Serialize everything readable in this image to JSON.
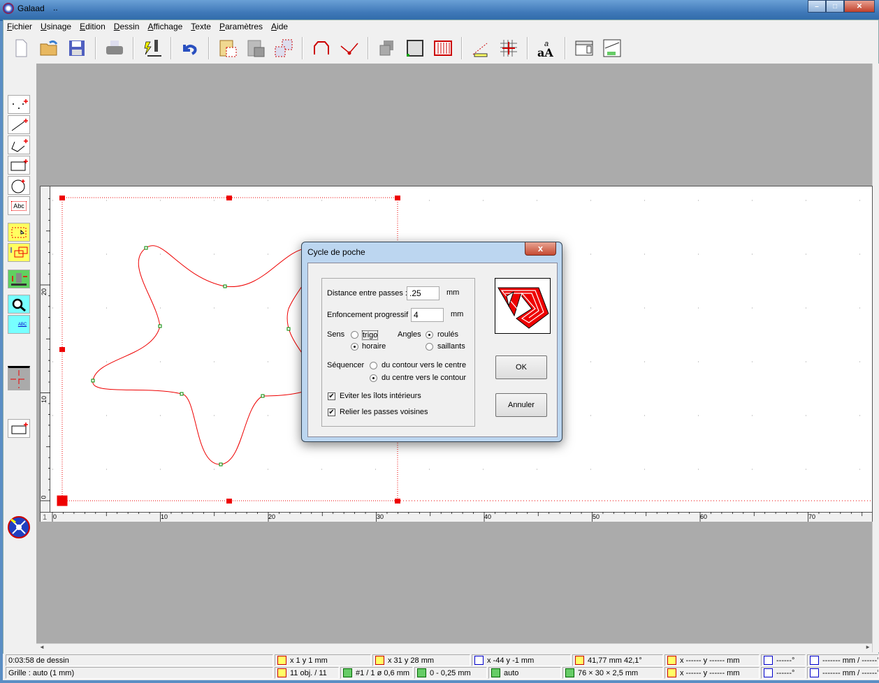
{
  "window": {
    "title": "Galaad",
    "title_extra": "..",
    "min": "–",
    "max": "□",
    "close": "✕"
  },
  "menu": [
    {
      "key": "F",
      "rest": "ichier"
    },
    {
      "key": "U",
      "rest": "sinage"
    },
    {
      "key": "E",
      "rest": "dition"
    },
    {
      "key": "D",
      "rest": "essin"
    },
    {
      "key": "A",
      "rest": "ffichage"
    },
    {
      "key": "T",
      "rest": "exte"
    },
    {
      "key": "P",
      "rest": "aramètres"
    },
    {
      "key": "A",
      "rest": "ide",
      "prefix": ""
    }
  ],
  "left_tools": {
    "text_tool": "Abc",
    "measure_tool": "ABC"
  },
  "rulers": {
    "x": [
      "0",
      "10",
      "20",
      "30",
      "40",
      "50",
      "60",
      "70"
    ],
    "y": [
      "0",
      "10",
      "20"
    ],
    "corner": "1"
  },
  "dialog": {
    "title": "Cycle de poche",
    "close": "x",
    "distance_label": "Distance entre passes :",
    "distance_value": ".25",
    "distance_unit": "mm",
    "enfoncement_label": "Enfoncement progressif :",
    "enfoncement_value": "4",
    "enfoncement_unit": "mm",
    "sens_label": "Sens",
    "sens_trigo": "trigo",
    "sens_horaire": "horaire",
    "angles_label": "Angles",
    "angles_roules": "roulés",
    "angles_saillants": "saillants",
    "sequencer_label": "Séquencer",
    "seq_contour_centre": "du contour vers le centre",
    "seq_centre_contour": "du centre vers le contour",
    "eviter_ilots": "Eviter les îlots intérieurs",
    "relier_passes": "Relier les passes voisines",
    "ok": "OK",
    "annuler": "Annuler",
    "state": {
      "sens": "horaire",
      "angles": "roulés",
      "sequencer": "du centre vers le contour",
      "eviter_ilots": true,
      "relier_passes": true
    }
  },
  "status": {
    "time": "0:03:58 de dessin",
    "grid": "Grille : auto  (1 mm)",
    "pos1": "x 1   y 1  mm",
    "pos2": "x 31   y 28  mm",
    "pos3": "x -44   y -1  mm",
    "dist": "41,77 mm   42,1°",
    "objects": "11 obj. / 11",
    "tool": "#1 / 1   ø 0,6 mm",
    "depth": "0 - 0,25 mm",
    "speed": "auto",
    "material": "76 × 30 × 2,5 mm",
    "xy_a": "x ------    y ------    mm",
    "xy_b": "x ------    y ------    mm",
    "angle_a": "------°",
    "angle_b": "------°",
    "mmdeg_a": "------- mm / ------°",
    "mmdeg_b": "------- mm / ------°",
    "check": "✔"
  }
}
